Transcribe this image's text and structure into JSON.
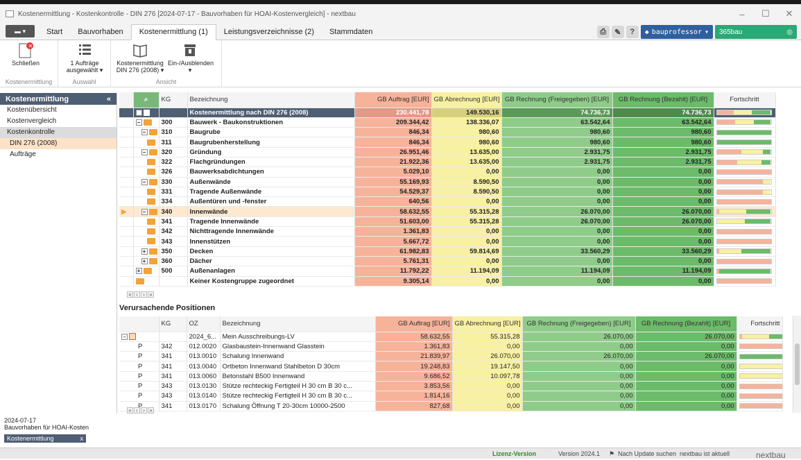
{
  "window": {
    "title": "Kostenermittlung - Kostenkontrolle - DIN 276 [2024-07-17 - Bauvorhaben für HOAI-Kostenvergleich] - nextbau",
    "minimize": "–",
    "maximize": "☐",
    "close": "✕"
  },
  "menu": {
    "app_button": "▬ ▾",
    "tabs": [
      "Start",
      "Bauvorhaben",
      "Kostenermittlung (1)",
      "Leistungsverzeichnisse (2)",
      "Stammdaten"
    ],
    "bauprofessor": "bauprofessor",
    "b365": "365bau"
  },
  "ribbon": {
    "close_label": "Schließen",
    "group1": "Kostenermittlung",
    "auftraege_label": "1 Aufträge ausgewählt ▾",
    "group2": "Auswahl",
    "din_label": "Kostenermittlung DIN 276 (2008) ▾",
    "einaus_label": "Ein-/Ausblenden ▾",
    "group3": "Ansicht"
  },
  "left": {
    "header": "Kostenermittlung",
    "collapse": "«",
    "items": [
      "Kostenübersicht",
      "Kostenvergleich",
      "Kostenkontrolle"
    ],
    "subitems": [
      "DIN 276 (2008)",
      "Aufträge"
    ]
  },
  "grid1": {
    "headers": {
      "kg": "KG",
      "bez": "Bezeichnung",
      "auf": "GB Auftrag [EUR]",
      "abr": "GB Abrechnung [EUR]",
      "fre": "GB Rechnung (Freigegeben) [EUR]",
      "bez2": "GB Rechnung (Bezahlt) [EUR]",
      "fort": "Fortschritt"
    },
    "rows": [
      {
        "kg": "",
        "bez": "Kostenermittlung nach DIN 276 (2008)",
        "auf": "230.441,78",
        "abr": "149.530,16",
        "fre": "74.736,73",
        "bez2": "74.736,73",
        "p": [
          0.32,
          0.33,
          0.35
        ]
      },
      {
        "kg": "300",
        "bez": "Bauwerk - Baukonstruktionen",
        "auf": "209.344,42",
        "abr": "138.336,07",
        "fre": "63.542,64",
        "bez2": "63.542,64",
        "p": [
          0.34,
          0.34,
          0.32
        ]
      },
      {
        "kg": "310",
        "bez": "Baugrube",
        "auf": "846,34",
        "abr": "980,60",
        "fre": "980,60",
        "bez2": "980,60",
        "p": [
          0,
          0,
          1
        ]
      },
      {
        "kg": "311",
        "bez": "Baugrubenherstellung",
        "auf": "846,34",
        "abr": "980,60",
        "fre": "980,60",
        "bez2": "980,60",
        "p": [
          0,
          0,
          1
        ]
      },
      {
        "kg": "320",
        "bez": "Gründung",
        "auf": "26.951,46",
        "abr": "13.635,00",
        "fre": "2.931,75",
        "bez2": "2.931,75",
        "p": [
          0.45,
          0.4,
          0.15
        ]
      },
      {
        "kg": "322",
        "bez": "Flachgründungen",
        "auf": "21.922,36",
        "abr": "13.635,00",
        "fre": "2.931,75",
        "bez2": "2.931,75",
        "p": [
          0.38,
          0.45,
          0.17
        ]
      },
      {
        "kg": "326",
        "bez": "Bauwerksabdichtungen",
        "auf": "5.029,10",
        "abr": "0,00",
        "fre": "0,00",
        "bez2": "0,00",
        "p": [
          1,
          0,
          0
        ]
      },
      {
        "kg": "330",
        "bez": "Außenwände",
        "auf": "55.169,93",
        "abr": "8.590,50",
        "fre": "0,00",
        "bez2": "0,00",
        "p": [
          0.85,
          0.15,
          0
        ]
      },
      {
        "kg": "331",
        "bez": "Tragende Außenwände",
        "auf": "54.529,37",
        "abr": "8.590,50",
        "fre": "0,00",
        "bez2": "0,00",
        "p": [
          0.85,
          0.15,
          0
        ]
      },
      {
        "kg": "334",
        "bez": "Außentüren und -fenster",
        "auf": "640,56",
        "abr": "0,00",
        "fre": "0,00",
        "bez2": "0,00",
        "p": [
          1,
          0,
          0
        ]
      },
      {
        "kg": "340",
        "bez": "Innenwände",
        "auf": "58.632,55",
        "abr": "55.315,28",
        "fre": "26.070,00",
        "bez2": "26.070,00",
        "p": [
          0.05,
          0.5,
          0.45
        ]
      },
      {
        "kg": "341",
        "bez": "Tragende Innenwände",
        "auf": "51.603,00",
        "abr": "55.315,28",
        "fre": "26.070,00",
        "bez2": "26.070,00",
        "p": [
          0,
          0.52,
          0.48
        ]
      },
      {
        "kg": "342",
        "bez": "Nichttragende Innenwände",
        "auf": "1.361,83",
        "abr": "0,00",
        "fre": "0,00",
        "bez2": "0,00",
        "p": [
          1,
          0,
          0
        ]
      },
      {
        "kg": "343",
        "bez": "Innenstützen",
        "auf": "5.667,72",
        "abr": "0,00",
        "fre": "0,00",
        "bez2": "0,00",
        "p": [
          1,
          0,
          0
        ]
      },
      {
        "kg": "350",
        "bez": "Decken",
        "auf": "61.982,83",
        "abr": "59.814,69",
        "fre": "33.560,29",
        "bez2": "33.560,29",
        "p": [
          0.04,
          0.42,
          0.54
        ]
      },
      {
        "kg": "360",
        "bez": "Dächer",
        "auf": "5.761,31",
        "abr": "0,00",
        "fre": "0,00",
        "bez2": "0,00",
        "p": [
          1,
          0,
          0
        ]
      },
      {
        "kg": "500",
        "bez": "Außenanlagen",
        "auf": "11.792,22",
        "abr": "11.194,09",
        "fre": "11.194,09",
        "bez2": "11.194,09",
        "p": [
          0.05,
          0,
          0.95
        ]
      },
      {
        "kg": "",
        "bez": "Keiner Kostengruppe zugeordnet",
        "auf": "9.305,14",
        "abr": "0,00",
        "fre": "0,00",
        "bez2": "0,00",
        "p": [
          1,
          0,
          0
        ]
      }
    ]
  },
  "grid2": {
    "title": "Verursachende Positionen",
    "headers": {
      "kg": "KG",
      "oz": "OZ",
      "bez": "Bezeichnung",
      "auf": "GB Auftrag [EUR]",
      "abr": "GB Abrechnung [EUR]",
      "fre": "GB Rechnung (Freigegeben) [EUR]",
      "bez2": "GB Rechnung (Bezahlt) [EUR]",
      "fort": "Fortschritt"
    },
    "rows": [
      {
        "t": "",
        "kg": "",
        "oz": "2024_6...",
        "bez": "Mein Ausschreibungs-LV",
        "auf": "58.632,55",
        "abr": "55.315,28",
        "fre": "26.070,00",
        "bez2": "26.070,00",
        "p": [
          0.05,
          0.5,
          0.45
        ]
      },
      {
        "t": "P",
        "kg": "342",
        "oz": "012.0020",
        "bez": "Glasbaustein-Innenwand Glasstein",
        "auf": "1.361,83",
        "abr": "0,00",
        "fre": "0,00",
        "bez2": "0,00",
        "p": [
          1,
          0,
          0
        ]
      },
      {
        "t": "P",
        "kg": "341",
        "oz": "013.0010",
        "bez": "Schalung Innenwand",
        "auf": "21.839,97",
        "abr": "26.070,00",
        "fre": "26.070,00",
        "bez2": "26.070,00",
        "p": [
          0,
          0,
          1
        ]
      },
      {
        "t": "P",
        "kg": "341",
        "oz": "013.0040",
        "bez": "Ortbeton Innenwand Stahlbeton D 30cm",
        "auf": "19.248,83",
        "abr": "19.147,50",
        "fre": "0,00",
        "bez2": "0,00",
        "p": [
          0,
          1,
          0
        ]
      },
      {
        "t": "P",
        "kg": "341",
        "oz": "013.0060",
        "bez": "Betonstahl B500 Innenwand",
        "auf": "9.686,52",
        "abr": "10.097,78",
        "fre": "0,00",
        "bez2": "0,00",
        "p": [
          0,
          1,
          0
        ]
      },
      {
        "t": "P",
        "kg": "343",
        "oz": "013.0130",
        "bez": "Stütze rechteckig Fertigteil H 30 cm B 30 c...",
        "auf": "3.853,56",
        "abr": "0,00",
        "fre": "0,00",
        "bez2": "0,00",
        "p": [
          1,
          0,
          0
        ]
      },
      {
        "t": "P",
        "kg": "343",
        "oz": "013.0140",
        "bez": "Stütze rechteckig Fertigteil H 30 cm B 30 c...",
        "auf": "1.814,16",
        "abr": "0,00",
        "fre": "0,00",
        "bez2": "0,00",
        "p": [
          1,
          0,
          0
        ]
      },
      {
        "t": "P",
        "kg": "341",
        "oz": "013.0170",
        "bez": "Schalung Öffnung T 20-30cm 10000-2500",
        "auf": "827,68",
        "abr": "0,00",
        "fre": "0,00",
        "bez2": "0,00",
        "p": [
          1,
          0,
          0
        ]
      }
    ]
  },
  "bottom": {
    "date": "2024-07-17",
    "project": "Bauvorhaben für HOAI-Kosten",
    "wtab": "Kostenermittlung",
    "wclose": "x"
  },
  "status": {
    "lizenz": "Lizenz-Version",
    "version": "Version 2024.1",
    "update": "Nach Update suchen",
    "aktuell": "nextbau ist aktuell",
    "brand": "nextbau"
  },
  "colors": {
    "auftrag": "#f6b39a",
    "abrechnung": "#f8f0a2",
    "freigegeben": "#8fcc8a",
    "bezahlt": "#6cbb6a",
    "header": "#4e5e73"
  }
}
